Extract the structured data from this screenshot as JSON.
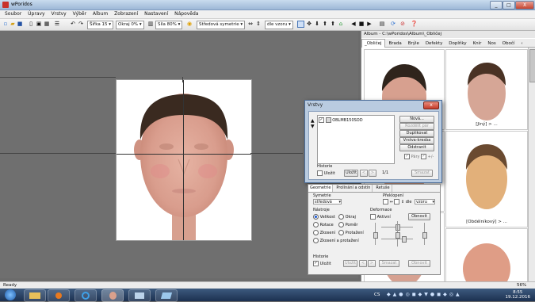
{
  "window": {
    "title": "wPoridos",
    "min_glyph": "_",
    "max_glyph": "□",
    "close_glyph": "X"
  },
  "menu": [
    "Soubor",
    "Úpravy",
    "Vrstvy",
    "Výběr",
    "Album",
    "Zobrazení",
    "Nastavení",
    "Nápověda"
  ],
  "toolbar": {
    "width_label": "Šířka 15",
    "feather_label": "Okraj 0%",
    "strength_label": "Síla 80%",
    "symmetry_label": "Středová symetrie",
    "pattern_label": "dle vzoru"
  },
  "album": {
    "path": "Album - C:\\wPoridos\\Album\\_Obličej",
    "tabs": [
      "_Obličej",
      "Brada",
      "Brýle",
      "Defekty",
      "Doplňky",
      "Knír",
      "Nos",
      "Obočí"
    ],
    "thumbs": [
      {
        "caption": ""
      },
      {
        "caption": "[Jiný] > ..."
      },
      {
        "caption": ""
      },
      {
        "caption": "[Obdélníkový] > ..."
      },
      {
        "caption": ""
      },
      {
        "caption": ""
      }
    ]
  },
  "layers_dialog": {
    "title": "Vrstvy",
    "close": "x",
    "layer_name": "OBLMB150SOD",
    "buttons": [
      "Nová...",
      "Rozdělit pár",
      "Duplikovat",
      "Vrstva-kresba",
      "Odstranit"
    ],
    "pairs_label": "Páry",
    "pairs_suffix": "+/-",
    "history_label": "Historie",
    "save_check_label": "Uložit",
    "save_button": "Uložit",
    "prev": "<",
    "next": ">",
    "counter": "1/1",
    "clear_button": "Smazat"
  },
  "tools_panel": {
    "tabs": [
      "Geometrie",
      "Prolínání a odstín",
      "Retuše"
    ],
    "symmetry_label": "Symetrie",
    "symmetry_value": "středová",
    "flip_label": "Překlopení",
    "flip_by": "dle",
    "flip_value": "vzoru",
    "tools_label": "Nástroje",
    "radios": [
      "Velikost",
      "Okraj",
      "Rotace",
      "Poměr",
      "Zkosení",
      "Protažení",
      "Zkosení a protažení"
    ],
    "deform_label": "Deformace",
    "active_label": "Aktivní",
    "refresh_button": "Obnovit",
    "history_label": "Historie",
    "save_check_label": "Uložit",
    "save_button": "Uložit",
    "prev": "<",
    "next": ">",
    "clear_button": "Smazat",
    "refresh2_button": "Obnovit"
  },
  "status": {
    "left": "Ready",
    "zoom": "56%"
  },
  "taskbar": {
    "lang": "CS",
    "time": "8:55",
    "date": "19.12.2016"
  },
  "colors": {
    "accent": "#3f6fb5",
    "dialog_frame": "#b9cbe0",
    "canvas": "#6f6f6f"
  }
}
